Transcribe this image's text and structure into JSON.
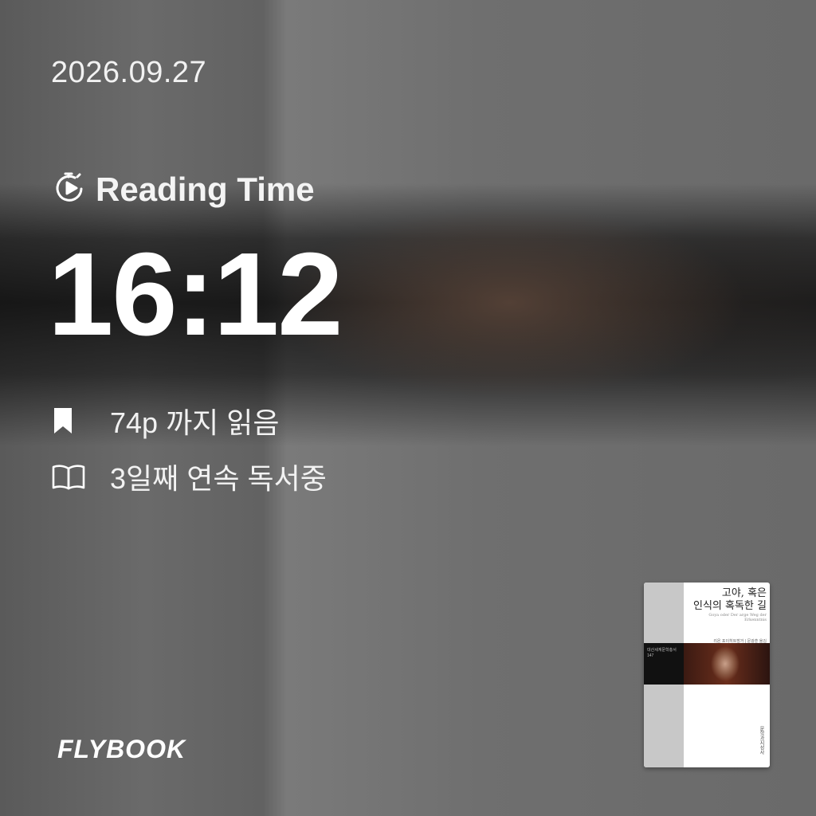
{
  "date": "2026.09.27",
  "reading_time": {
    "label": "Reading Time",
    "icon": "stopwatch-play-icon",
    "value": "16:12"
  },
  "stats": [
    {
      "icon": "bookmark-icon",
      "text": "74p 까지 읽음"
    },
    {
      "icon": "open-book-icon",
      "text": "3일째 연속 독서중"
    }
  ],
  "brand": "FLYBOOK",
  "book_cover": {
    "title_line1": "고야, 혹은",
    "title_line2": "인식의 혹독한 길",
    "subtitle": "Goya oder Der arge Weg der Erkenntnis",
    "series": "대산세계문학총서",
    "series_number": "147",
    "author": "리온 포이히트방거 | 문광훈 옮김",
    "publisher": "문학과지성사"
  },
  "colors": {
    "text": "#ffffff",
    "background": "#6d6d6d"
  }
}
